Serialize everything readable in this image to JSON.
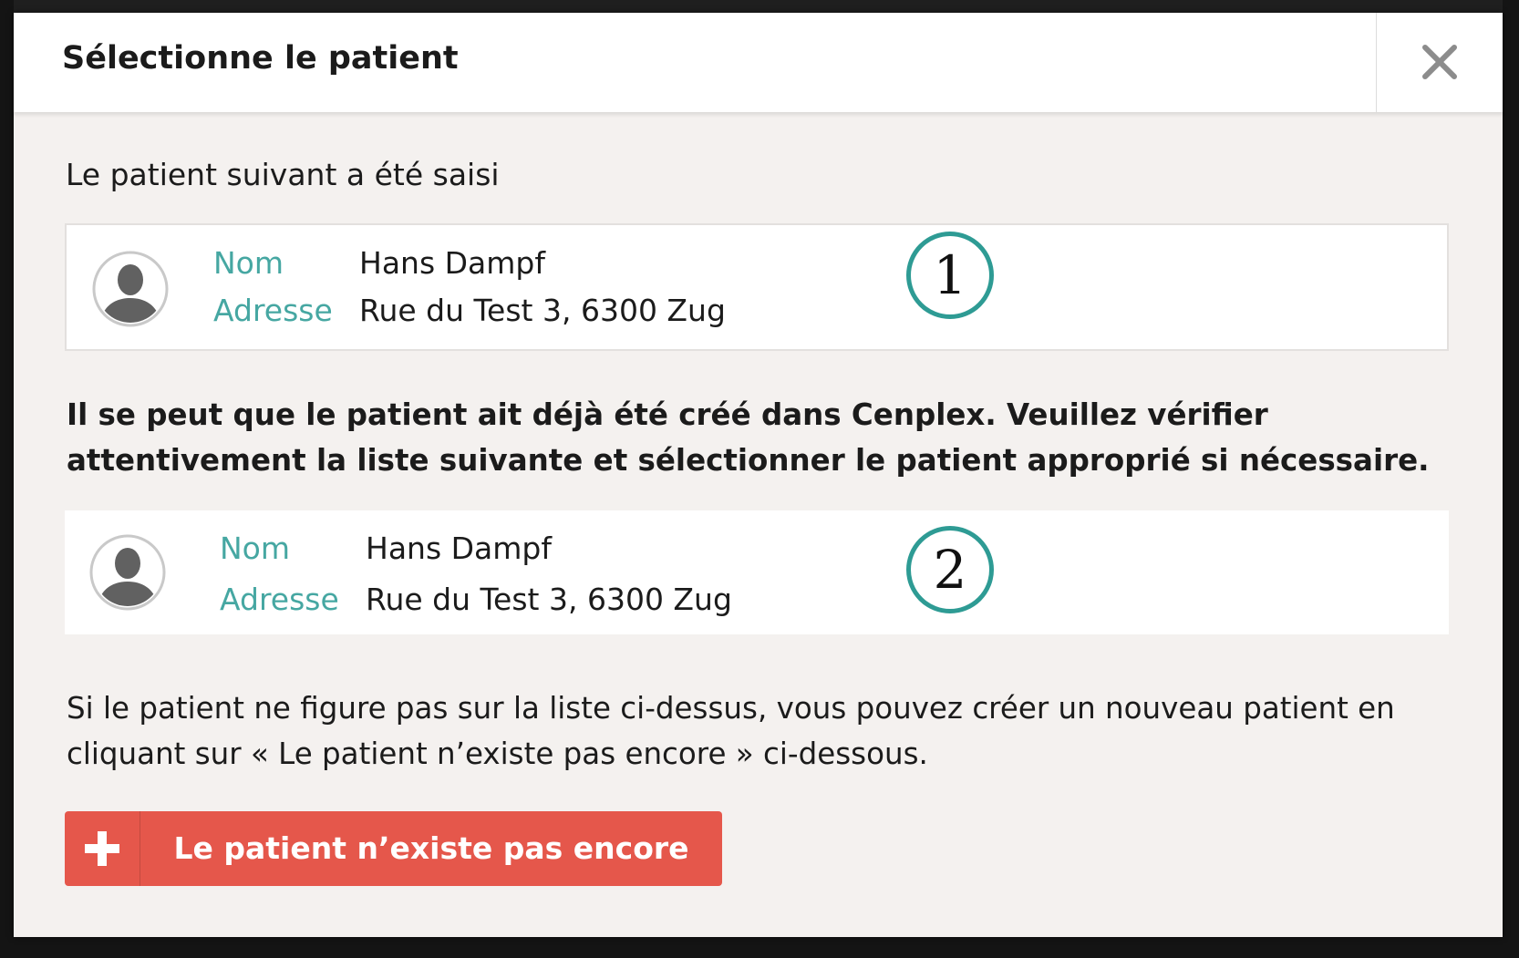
{
  "dialog": {
    "title": "Sélectionne le patient",
    "intro": "Le patient suivant a été saisi",
    "warning": "Il se peut que le patient ait déjà été créé dans Cenplex. Veuillez vérifier attentivement la liste suivante et sélectionner le patient approprié si nécessaire.",
    "hint": "Si le patient ne figure pas sur la liste ci-dessus, vous pouvez créer un nouveau patient en cliquant sur « Le patient n’existe pas encore » ci-dessous."
  },
  "entered_patient": {
    "name_label": "Nom",
    "name": "Hans Dampf",
    "address_label": "Adresse",
    "address": "Rue du Test 3, 6300 Zug",
    "marker": "1"
  },
  "matched_patient": {
    "name_label": "Nom",
    "name": "Hans Dampf",
    "address_label": "Adresse",
    "address": "Rue du Test 3, 6300 Zug",
    "marker": "2"
  },
  "create_button": {
    "label": "Le patient n’existe pas encore",
    "icon": "plus-icon"
  },
  "icons": {
    "close": "close-icon",
    "avatar": "user-avatar-icon"
  },
  "colors": {
    "accent_teal": "#46a7a2",
    "marker_teal": "#2e9b94",
    "button_red": "#e5574b",
    "background": "#f4f1ef"
  }
}
